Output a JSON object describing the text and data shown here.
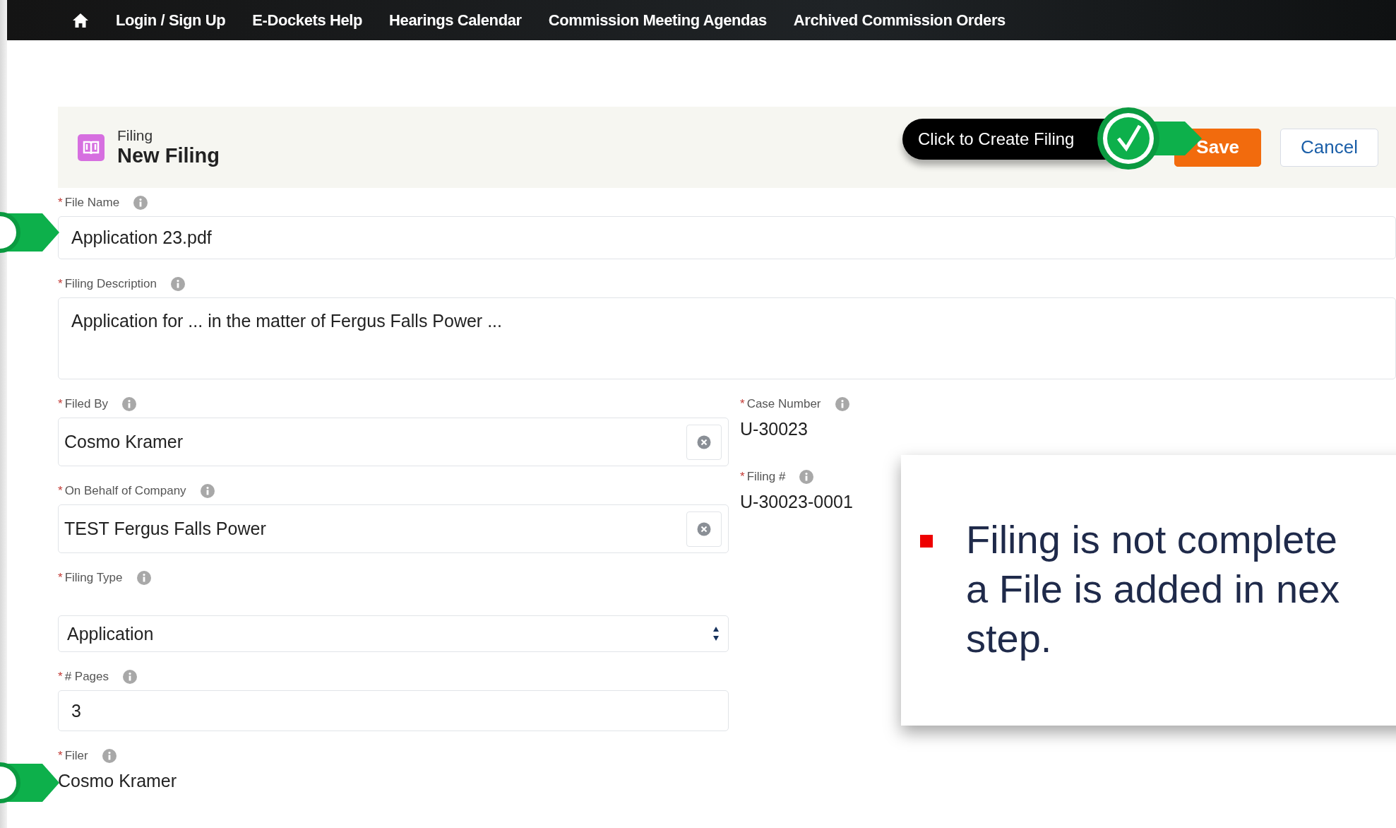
{
  "nav": {
    "items": [
      {
        "label": "Login / Sign Up"
      },
      {
        "label": "E-Dockets Help"
      },
      {
        "label": "Hearings Calendar"
      },
      {
        "label": "Commission Meeting Agendas"
      },
      {
        "label": "Archived Commission Orders"
      }
    ]
  },
  "header": {
    "object": "Filing",
    "title": "New Filing"
  },
  "tooltip": {
    "text": "Click to Create Filing"
  },
  "actions": [
    {
      "label": "Save",
      "kind": "primary"
    },
    {
      "label": "Cancel",
      "kind": "neutral"
    }
  ],
  "form": {
    "wide_fields": [
      {
        "kind": "text",
        "required_mark": "*",
        "label": "File Name",
        "value": "Application 23.pdf",
        "pointer": true
      },
      {
        "kind": "textarea",
        "required_mark": "*",
        "label": "Filing Description",
        "value": "Application for ... in the matter of Fergus Falls Power ...",
        "pointer": false
      }
    ],
    "left_fields": [
      {
        "kind": "lookup",
        "required_mark": "*",
        "label": "Filed By",
        "value": "Cosmo Kramer",
        "pointer": false
      },
      {
        "kind": "lookup",
        "required_mark": "*",
        "label": "On Behalf of Company",
        "value": "TEST Fergus Falls Power",
        "pointer": false
      },
      {
        "kind": "select",
        "required_mark": "*",
        "label": "Filing Type",
        "value": "Application",
        "pointer": false
      },
      {
        "kind": "text",
        "required_mark": "*",
        "label": "# Pages",
        "value": "3",
        "pointer": false
      },
      {
        "kind": "readonly",
        "required_mark": "*",
        "label": "Filer",
        "value": "Cosmo Kramer",
        "pointer": true
      }
    ],
    "right_fields": [
      {
        "kind": "readonly",
        "required_mark": "*",
        "label": "Case Number",
        "value": "U-30023",
        "pointer": false
      },
      {
        "kind": "readonly",
        "required_mark": "*",
        "label": "Filing #",
        "value": "U-30023-0001",
        "pointer": false
      }
    ]
  },
  "note": {
    "lines": [
      "Filing is not complete",
      "a File is added in nex",
      "step."
    ]
  }
}
